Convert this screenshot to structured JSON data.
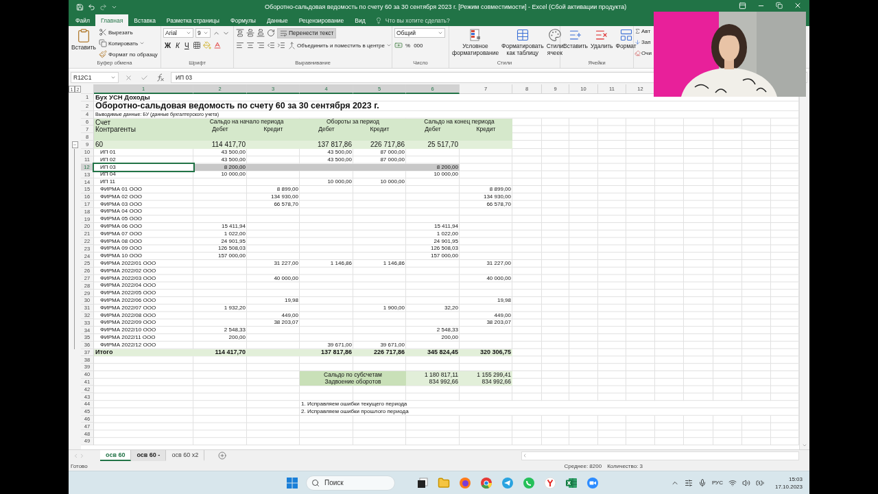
{
  "window": {
    "title": "Оборотно-сальдовая ведомость по счету 60 за 30 сентября 2023 г.  [Режим совместимости] - Excel (Сбой активации продукта)"
  },
  "ribbon_tabs": [
    {
      "label": "Файл",
      "selected": false
    },
    {
      "label": "Главная",
      "selected": true
    },
    {
      "label": "Вставка",
      "selected": false
    },
    {
      "label": "Разметка страницы",
      "selected": false
    },
    {
      "label": "Формулы",
      "selected": false
    },
    {
      "label": "Данные",
      "selected": false
    },
    {
      "label": "Рецензирование",
      "selected": false
    },
    {
      "label": "Вид",
      "selected": false
    }
  ],
  "tell_me": {
    "placeholder": "Что вы хотите сделать?"
  },
  "ribbon": {
    "clipboard": {
      "paste": "Вставить",
      "cut": "Вырезать",
      "copy": "Копировать",
      "format_painter": "Формат по образцу",
      "label": "Буфер обмена"
    },
    "font": {
      "name": "Arial",
      "size": "9",
      "bold": "Ж",
      "italic": "К",
      "underline": "Ч",
      "label": "Шрифт"
    },
    "alignment": {
      "wrap_text": {
        "label": "Перенести текст",
        "on": true
      },
      "merge": "Объединить и поместить в центре",
      "label": "Выравнивание"
    },
    "number": {
      "format": "Общий",
      "percent": "%",
      "thousands": "000",
      "label": "Число"
    },
    "styles": {
      "buttons": [
        "Условное форматирование",
        "Форматировать как таблицу",
        "Стили ячеек"
      ],
      "label": "Стили"
    },
    "cells": {
      "buttons": [
        "Вставить",
        "Удалить",
        "Формат"
      ],
      "label": "Ячейки"
    },
    "editing": {
      "buttons": [
        "Авт",
        "Зап",
        "Очи"
      ]
    }
  },
  "formula_bar": {
    "name_box": "R12C1",
    "value": "ИП 03"
  },
  "sheet": {
    "outline_levels": [
      "1",
      "2"
    ],
    "columns": [
      {
        "label": "1",
        "selected": true
      },
      {
        "label": "2",
        "selected": true
      },
      {
        "label": "3",
        "selected": true
      },
      {
        "label": "4",
        "selected": true
      },
      {
        "label": "5",
        "selected": true
      },
      {
        "label": "6",
        "selected": true
      },
      {
        "label": "7",
        "selected": false
      },
      {
        "label": "8",
        "selected": false
      },
      {
        "label": "9",
        "selected": false
      },
      {
        "label": "10",
        "selected": false
      },
      {
        "label": "11",
        "selected": false
      },
      {
        "label": "12",
        "selected": false
      }
    ],
    "rows": [
      {
        "number": "1",
        "kind": "heading",
        "selected": false,
        "cells": {
          "1": "Бух УСН Доходы"
        }
      },
      {
        "number": "2",
        "kind": "title",
        "selected": false,
        "cells": {
          "1": "Оборотно-сальдовая ведомость по счету 60 за 30 сентября 2023 г."
        }
      },
      {
        "number": "4",
        "kind": "caption",
        "selected": false,
        "cells": {
          "1": "Выводимые данные: БУ (данные бухгалтерского учета)"
        }
      },
      {
        "number": "6",
        "kind": "band",
        "selected": false,
        "cells": {
          "1": "Счет",
          "2": "Сальдо на начало периода",
          "4": "Обороты за период",
          "6": "Сальдо на конец периода"
        }
      },
      {
        "number": "7",
        "kind": "subheader",
        "selected": false,
        "cells": {
          "1": "Контрагенты",
          "2": "Дебет",
          "3": "Кредит",
          "4": "Дебет",
          "5": "Кредит",
          "6": "Дебет",
          "7": "Кредит"
        }
      },
      {
        "number": "8",
        "kind": "spacer",
        "selected": false,
        "cells": {}
      },
      {
        "number": "9",
        "kind": "group",
        "selected": false,
        "expanded": true,
        "cells": {
          "1": "60",
          "2": "114 417,70",
          "4": "137 817,86",
          "5": "226 717,86",
          "6": "25 517,70"
        },
        "children": [
          {
            "number": "10",
            "kind": "item",
            "selected": false,
            "cells": {
              "1": "ИП 01",
              "2": "43 500,00",
              "4": "43 500,00",
              "5": "87 000,00"
            }
          },
          {
            "number": "11",
            "kind": "item",
            "selected": false,
            "cells": {
              "1": "ИП 02",
              "2": "43 500,00",
              "4": "43 500,00",
              "5": "87 000,00"
            }
          },
          {
            "number": "12",
            "kind": "item",
            "selected": true,
            "cells": {
              "1": "ИП 03",
              "2": "8 200,00",
              "6": "8 200,00"
            }
          },
          {
            "number": "13",
            "kind": "item",
            "selected": false,
            "cells": {
              "1": "ИП 04",
              "2": "10 000,00",
              "6": "10 000,00"
            }
          },
          {
            "number": "14",
            "kind": "item",
            "selected": false,
            "cells": {
              "1": "ИП 11",
              "4": "10 000,00",
              "5": "10 000,00"
            }
          },
          {
            "number": "15",
            "kind": "item",
            "selected": false,
            "cells": {
              "1": "ФИРМА 01 ООО",
              "3": "8 899,00",
              "7": "8 899,00"
            }
          },
          {
            "number": "16",
            "kind": "item",
            "selected": false,
            "cells": {
              "1": "ФИРМА 02 ООО",
              "3": "134 930,00",
              "7": "134 930,00"
            }
          },
          {
            "number": "17",
            "kind": "item",
            "selected": false,
            "cells": {
              "1": "ФИРМА 03 ООО",
              "3": "66 578,70",
              "7": "66 578,70"
            }
          },
          {
            "number": "18",
            "kind": "item",
            "selected": false,
            "cells": {
              "1": "ФИРМА 04 ООО"
            }
          },
          {
            "number": "19",
            "kind": "item",
            "selected": false,
            "cells": {
              "1": "ФИРМА 05 ООО"
            }
          },
          {
            "number": "20",
            "kind": "item",
            "selected": false,
            "cells": {
              "1": "ФИРМА 06 ООО",
              "2": "15 411,94",
              "6": "15 411,94"
            }
          },
          {
            "number": "21",
            "kind": "item",
            "selected": false,
            "cells": {
              "1": "ФИРМА 07 ООО",
              "2": "1 022,00",
              "6": "1 022,00"
            }
          },
          {
            "number": "22",
            "kind": "item",
            "selected": false,
            "cells": {
              "1": "ФИРМА 08 ООО",
              "2": "24 901,95",
              "6": "24 901,95"
            }
          },
          {
            "number": "23",
            "kind": "item",
            "selected": false,
            "cells": {
              "1": "ФИРМА 09 ООО",
              "2": "126 508,03",
              "6": "126 508,03"
            }
          },
          {
            "number": "24",
            "kind": "item",
            "selected": false,
            "cells": {
              "1": "ФИРМА 10 ООО",
              "2": "157 000,00",
              "6": "157 000,00"
            }
          },
          {
            "number": "25",
            "kind": "item",
            "selected": false,
            "cells": {
              "1": "ФИРМА 2022/01 ООО",
              "3": "31 227,00",
              "4": "1 146,86",
              "5": "1 146,86",
              "7": "31 227,00"
            }
          },
          {
            "number": "26",
            "kind": "item",
            "selected": false,
            "cells": {
              "1": "ФИРМА 2022/02 ООО"
            }
          },
          {
            "number": "27",
            "kind": "item",
            "selected": false,
            "cells": {
              "1": "ФИРМА 2022/03 ООО",
              "3": "40 000,00",
              "7": "40 000,00"
            }
          },
          {
            "number": "28",
            "kind": "item",
            "selected": false,
            "cells": {
              "1": "ФИРМА 2022/04 ООО"
            }
          },
          {
            "number": "29",
            "kind": "item",
            "selected": false,
            "cells": {
              "1": "ФИРМА 2022/05 ООО"
            }
          },
          {
            "number": "30",
            "kind": "item",
            "selected": false,
            "cells": {
              "1": "ФИРМА 2022/06 ООО",
              "3": "19,98",
              "7": "19,98"
            }
          },
          {
            "number": "31",
            "kind": "item",
            "selected": false,
            "cells": {
              "1": "ФИРМА 2022/07 ООО",
              "2": "1 932,20",
              "5": "1 900,00",
              "6": "32,20"
            }
          },
          {
            "number": "32",
            "kind": "item",
            "selected": false,
            "cells": {
              "1": "ФИРМА 2022/08 ООО",
              "3": "449,00",
              "7": "449,00"
            }
          },
          {
            "number": "33",
            "kind": "item",
            "selected": false,
            "cells": {
              "1": "ФИРМА 2022/09 ООО",
              "3": "38 203,07",
              "7": "38 203,07"
            }
          },
          {
            "number": "34",
            "kind": "item",
            "selected": false,
            "cells": {
              "1": "ФИРМА 2022/10 ООО",
              "2": "2 548,33",
              "6": "2 548,33"
            }
          },
          {
            "number": "35",
            "kind": "item",
            "selected": false,
            "cells": {
              "1": "ФИРМА 2022/11 ООО",
              "2": "200,00",
              "6": "200,00"
            }
          },
          {
            "number": "36",
            "kind": "item",
            "selected": false,
            "cells": {
              "1": "ФИРМА 2022/12 ООО",
              "4": "39 671,00",
              "5": "39 671,00"
            }
          }
        ]
      },
      {
        "number": "37",
        "kind": "total",
        "selected": false,
        "cells": {
          "1": "Итого",
          "2": "114 417,70",
          "4": "137 817,86",
          "5": "226 717,86",
          "6": "345 824,45",
          "7": "320 306,75"
        }
      },
      {
        "number": "38",
        "kind": "empty",
        "selected": false,
        "cells": {}
      },
      {
        "number": "39",
        "kind": "empty",
        "selected": false,
        "cells": {}
      },
      {
        "number": "40",
        "kind": "summary",
        "selected": false,
        "cells": {
          "4": "Сальдо по субсчетам",
          "6": "1 180 817,11",
          "7": "1 155 299,41"
        }
      },
      {
        "number": "41",
        "kind": "summary",
        "selected": false,
        "cells": {
          "4": "Задвоение оборотов",
          "6": "834 992,66",
          "7": "834 992,66"
        }
      },
      {
        "number": "42",
        "kind": "empty",
        "selected": false,
        "cells": {}
      },
      {
        "number": "43",
        "kind": "empty",
        "selected": false,
        "cells": {}
      },
      {
        "number": "44",
        "kind": "note",
        "selected": false,
        "cells": {
          "4": "1. Исправляем ошибки текущего периода"
        }
      },
      {
        "number": "45",
        "kind": "note",
        "selected": false,
        "cells": {
          "4": "2. Исправляем ошибки прошлого периода"
        }
      },
      {
        "number": "46",
        "kind": "empty",
        "selected": false,
        "cells": {}
      },
      {
        "number": "47",
        "kind": "empty",
        "selected": false,
        "cells": {}
      },
      {
        "number": "48",
        "kind": "empty",
        "selected": false,
        "cells": {}
      },
      {
        "number": "49",
        "kind": "empty",
        "selected": false,
        "cells": {}
      }
    ]
  },
  "sheet_tabs": [
    {
      "label": "осв 60",
      "selected": true,
      "hovered": false
    },
    {
      "label": "осв 60 -",
      "selected": false,
      "hovered": true
    },
    {
      "label": "осв 60 x2",
      "selected": false,
      "hovered": false
    }
  ],
  "status_bar": {
    "state": "Готово",
    "average": "Среднее: 8200",
    "count": "Количество: 3"
  },
  "taskbar": {
    "search": {
      "placeholder": "Поиск"
    },
    "language": "РУС",
    "time": "15:03",
    "date": "17.10.2023"
  }
}
